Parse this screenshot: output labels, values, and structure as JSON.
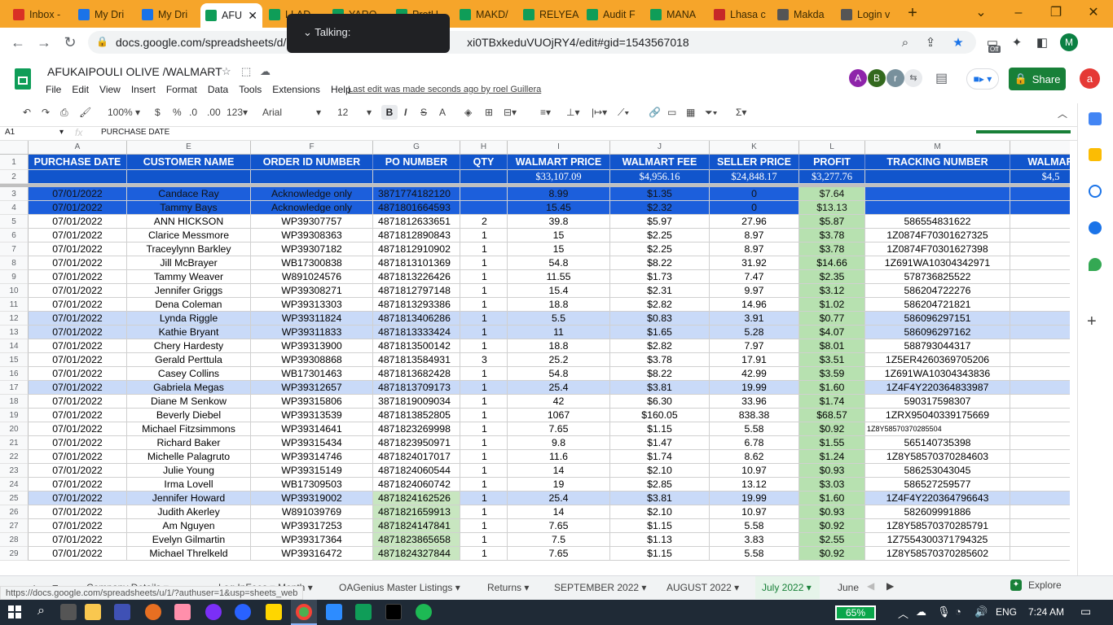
{
  "browser": {
    "tabs": [
      {
        "title": "Inbox -",
        "icon": "gmail-icon",
        "color": "#d93025"
      },
      {
        "title": "My Dri",
        "icon": "drive-icon",
        "color": "#1a73e8"
      },
      {
        "title": "My Dri",
        "icon": "drive-icon",
        "color": "#1a73e8"
      },
      {
        "title": "AFU",
        "icon": "sheets-icon",
        "color": "#0f9d58"
      },
      {
        "title": "LLAD",
        "icon": "sheets-icon",
        "color": "#0f9d58"
      },
      {
        "title": "YARO",
        "icon": "sheets-icon",
        "color": "#0f9d58"
      },
      {
        "title": "ProtU",
        "icon": "sheets-icon",
        "color": "#0f9d58"
      },
      {
        "title": "MAKD/",
        "icon": "sheets-icon",
        "color": "#0f9d58"
      },
      {
        "title": "RELYEA",
        "icon": "sheets-icon",
        "color": "#0f9d58"
      },
      {
        "title": "Audit F",
        "icon": "sheets-icon",
        "color": "#0f9d58"
      },
      {
        "title": "MANA",
        "icon": "sheets-icon",
        "color": "#0f9d58"
      },
      {
        "title": "Lhasa c",
        "icon": "vivaldi-icon",
        "color": "#c62828"
      },
      {
        "title": "Makda",
        "icon": "globe-icon",
        "color": "#555555"
      },
      {
        "title": "Login v",
        "icon": "globe-icon",
        "color": "#555555"
      }
    ],
    "url": "docs.google.com/spreadsheets/d/1",
    "url_tail": "xi0TBxkeduVUOjRY4/edit#gid=1543567018",
    "talking_popup": "Talking:",
    "profile_initial": "M",
    "ext_badge": "Off"
  },
  "sheet": {
    "title": "AFUKAIPOULI OLIVE /WALMART",
    "menu": [
      "File",
      "Edit",
      "View",
      "Insert",
      "Format",
      "Data",
      "Tools",
      "Extensions",
      "Help"
    ],
    "last_edit": "Last edit was made seconds ago by roel Guillera",
    "avatars": [
      {
        "letter": "A",
        "color": "#8e24aa"
      },
      {
        "letter": "B",
        "color": "#33691e"
      },
      {
        "letter": "r",
        "color": "#78909c"
      }
    ],
    "share_label": "Share",
    "account_initial": "a",
    "toolbar": {
      "zoom": "100%",
      "currency": "$",
      "percent": "%",
      "dec_less": ".0",
      "dec_more": ".00",
      "format": "123",
      "font": "Arial",
      "font_size": "12"
    },
    "cell_ref": "A1",
    "fx_label": "fx",
    "formula": "PURCHASE DATE"
  },
  "grid": {
    "columns": [
      {
        "letter": "A",
        "header": "PURCHASE DATE"
      },
      {
        "letter": "E",
        "header": "CUSTOMER NAME"
      },
      {
        "letter": "F",
        "header": "ORDER ID NUMBER"
      },
      {
        "letter": "G",
        "header": "PO NUMBER"
      },
      {
        "letter": "H",
        "header": "QTY"
      },
      {
        "letter": "I",
        "header": "WALMART PRICE"
      },
      {
        "letter": "J",
        "header": "WALMART FEE"
      },
      {
        "letter": "K",
        "header": "SELLER PRICE"
      },
      {
        "letter": "L",
        "header": "PROFIT"
      },
      {
        "letter": "M",
        "header": "TRACKING NUMBER"
      },
      {
        "letter": "",
        "header": "WALMAR"
      }
    ],
    "totals": {
      "I": "$33,107.09",
      "J": "$4,956.16",
      "K": "$24,848.17",
      "L": "$3,277.76",
      "N": "$4,5"
    },
    "rows": [
      {
        "n": "3",
        "style": "blue",
        "A": "07/01/2022",
        "E": "Candace Ray",
        "F": "Acknowledge only",
        "G": "3871774182120",
        "H": "",
        "I": "8.99",
        "J": "$1.35",
        "K": "0",
        "L": "$7.64",
        "M": ""
      },
      {
        "n": "4",
        "style": "blue",
        "A": "07/01/2022",
        "E": "Tammy Bays",
        "F": "Acknowledge only",
        "G": "4871801664593",
        "H": "",
        "I": "15.45",
        "J": "$2.32",
        "K": "0",
        "L": "$13.13",
        "M": ""
      },
      {
        "n": "5",
        "style": "",
        "A": "07/01/2022",
        "E": "ANN HICKSON",
        "F": "WP39307757",
        "G": "4871812633651",
        "H": "2",
        "I": "39.8",
        "J": "$5.97",
        "K": "27.96",
        "L": "$5.87",
        "M": "586554831622"
      },
      {
        "n": "6",
        "style": "",
        "A": "07/01/2022",
        "E": "Clarice Messmore",
        "F": "WP39308363",
        "G": "4871812890843",
        "H": "1",
        "I": "15",
        "J": "$2.25",
        "K": "8.97",
        "L": "$3.78",
        "M": "1Z0874F70301627325"
      },
      {
        "n": "7",
        "style": "",
        "A": "07/01/2022",
        "E": "Traceylynn Barkley",
        "F": "WP39307182",
        "G": "4871812910902",
        "H": "1",
        "I": "15",
        "J": "$2.25",
        "K": "8.97",
        "L": "$3.78",
        "M": "1Z0874F70301627398"
      },
      {
        "n": "8",
        "style": "",
        "A": "07/01/2022",
        "E": "Jill McBrayer",
        "F": "WB17300838",
        "G": "4871813101369",
        "H": "1",
        "I": "54.8",
        "J": "$8.22",
        "K": "31.92",
        "L": "$14.66",
        "M": "1Z691WA10304342971"
      },
      {
        "n": "9",
        "style": "",
        "A": "07/01/2022",
        "E": "Tammy Weaver",
        "F": "W891024576",
        "G": "4871813226426",
        "H": "1",
        "I": "11.55",
        "J": "$1.73",
        "K": "7.47",
        "L": "$2.35",
        "M": "578736825522"
      },
      {
        "n": "10",
        "style": "",
        "A": "07/01/2022",
        "E": "Jennifer Griggs",
        "F": "WP39308271",
        "G": "4871812797148",
        "H": "1",
        "I": "15.4",
        "J": "$2.31",
        "K": "9.97",
        "L": "$3.12",
        "M": "586204722276"
      },
      {
        "n": "11",
        "style": "",
        "A": "07/01/2022",
        "E": "Dena Coleman",
        "F": "WP39313303",
        "G": "4871813293386",
        "H": "1",
        "I": "18.8",
        "J": "$2.82",
        "K": "14.96",
        "L": "$1.02",
        "M": "586204721821"
      },
      {
        "n": "12",
        "style": "lblue",
        "A": "07/01/2022",
        "E": "Lynda Riggle",
        "F": "WP39311824",
        "G": "4871813406286",
        "H": "1",
        "I": "5.5",
        "J": "$0.83",
        "K": "3.91",
        "L": "$0.77",
        "M": "586096297151"
      },
      {
        "n": "13",
        "style": "lblue",
        "A": "07/01/2022",
        "E": "Kathie Bryant",
        "F": "WP39311833",
        "G": "4871813333424",
        "H": "1",
        "I": "11",
        "J": "$1.65",
        "K": "5.28",
        "L": "$4.07",
        "M": "586096297162"
      },
      {
        "n": "14",
        "style": "",
        "A": "07/01/2022",
        "E": "Chery Hardesty",
        "F": "WP39313900",
        "G": "4871813500142",
        "H": "1",
        "I": "18.8",
        "J": "$2.82",
        "K": "7.97",
        "L": "$8.01",
        "M": "588793044317"
      },
      {
        "n": "15",
        "style": "",
        "A": "07/01/2022",
        "E": "Gerald Perttula",
        "F": "WP39308868",
        "G": "4871813584931",
        "H": "3",
        "I": "25.2",
        "J": "$3.78",
        "K": "17.91",
        "L": "$3.51",
        "M": "1Z5ER4260369705206"
      },
      {
        "n": "16",
        "style": "",
        "A": "07/01/2022",
        "E": "Casey Collins",
        "F": "WB17301463",
        "G": "4871813682428",
        "H": "1",
        "I": "54.8",
        "J": "$8.22",
        "K": "42.99",
        "L": "$3.59",
        "M": "1Z691WA10304343836"
      },
      {
        "n": "17",
        "style": "lblue",
        "A": "07/01/2022",
        "E": "Gabriela Megas",
        "F": "WP39312657",
        "G": "4871813709173",
        "H": "1",
        "I": "25.4",
        "J": "$3.81",
        "K": "19.99",
        "L": "$1.60",
        "M": "1Z4F4Y220364833987"
      },
      {
        "n": "18",
        "style": "",
        "A": "07/01/2022",
        "E": "Diane M Senkow",
        "F": "WP39315806",
        "G": "3871819009034",
        "H": "1",
        "I": "42",
        "J": "$6.30",
        "K": "33.96",
        "L": "$1.74",
        "M": "590317598307"
      },
      {
        "n": "19",
        "style": "",
        "A": "07/01/2022",
        "E": "Beverly Diebel",
        "F": "WP39313539",
        "G": "4871813852805",
        "H": "1",
        "I": "1067",
        "J": "$160.05",
        "K": "838.38",
        "L": "$68.57",
        "M": "1ZRX95040339175669"
      },
      {
        "n": "20",
        "style": "",
        "A": "07/01/2022",
        "E": "Michael Fitzsimmons",
        "F": "WP39314641",
        "G": "4871823269998",
        "H": "1",
        "I": "7.65",
        "J": "$1.15",
        "K": "5.58",
        "L": "$0.92",
        "M": "1Z8Y58570370285504",
        "Msmall": true
      },
      {
        "n": "21",
        "style": "",
        "A": "07/01/2022",
        "E": "Richard Baker",
        "F": "WP39315434",
        "G": "4871823950971",
        "H": "1",
        "I": "9.8",
        "J": "$1.47",
        "K": "6.78",
        "L": "$1.55",
        "M": "565140735398"
      },
      {
        "n": "22",
        "style": "",
        "A": "07/01/2022",
        "E": "Michelle Palagruto",
        "F": "WP39314746",
        "G": "4871824017017",
        "H": "1",
        "I": "11.6",
        "J": "$1.74",
        "K": "8.62",
        "L": "$1.24",
        "M": "1Z8Y58570370284603"
      },
      {
        "n": "23",
        "style": "",
        "A": "07/01/2022",
        "E": "Julie Young",
        "F": "WP39315149",
        "G": "4871824060544",
        "H": "1",
        "I": "14",
        "J": "$2.10",
        "K": "10.97",
        "L": "$0.93",
        "M": "586253043045"
      },
      {
        "n": "24",
        "style": "",
        "A": "07/01/2022",
        "E": "Irma Lovell",
        "F": "WB17309503",
        "G": "4871824060742",
        "H": "1",
        "I": "19",
        "J": "$2.85",
        "K": "13.12",
        "L": "$3.03",
        "M": "586527259577"
      },
      {
        "n": "25",
        "style": "lblue",
        "A": "07/01/2022",
        "E": "Jennifer Howard",
        "F": "WP39319002",
        "G": "4871824162526",
        "H": "1",
        "I": "25.4",
        "J": "$3.81",
        "K": "19.99",
        "L": "$1.60",
        "M": "1Z4F4Y220364796643",
        "Ggreen": true
      },
      {
        "n": "26",
        "style": "",
        "A": "07/01/2022",
        "E": "Judith Akerley",
        "F": "W891039769",
        "G": "4871821659913",
        "H": "1",
        "I": "14",
        "J": "$2.10",
        "K": "10.97",
        "L": "$0.93",
        "M": "582609991886",
        "Ggreen": true
      },
      {
        "n": "27",
        "style": "",
        "A": "07/01/2022",
        "E": "Am Nguyen",
        "F": "WP39317253",
        "G": "4871824147841",
        "H": "1",
        "I": "7.65",
        "J": "$1.15",
        "K": "5.58",
        "L": "$0.92",
        "M": "1Z8Y58570370285791",
        "Ggreen": true
      },
      {
        "n": "28",
        "style": "",
        "A": "07/01/2022",
        "E": "Evelyn Gilmartin",
        "F": "WP39317364",
        "G": "4871823865658",
        "H": "1",
        "I": "7.5",
        "J": "$1.13",
        "K": "3.83",
        "L": "$2.55",
        "M": "1Z7554300371794325",
        "Ggreen": true
      },
      {
        "n": "29",
        "style": "",
        "A": "07/01/2022",
        "E": "Michael Threlkeld",
        "F": "WP39316472",
        "G": "4871824327844",
        "H": "1",
        "I": "7.65",
        "J": "$1.15",
        "K": "5.58",
        "L": "$0.92",
        "M": "1Z8Y58570370285602",
        "Ggreen": true
      }
    ]
  },
  "sheet_tabs": [
    "Company Details",
    "Log InFees",
    "Month",
    "OAGenius Master Listings",
    "Returns",
    "SEPTEMBER 2022",
    "AUGUST 2022",
    "July 2022",
    "June"
  ],
  "active_sheet_tab": "July 2022",
  "explore_label": "Explore",
  "status_url": "https://docs.google.com/spreadsheets/u/1/?authuser=1&usp=sheets_web",
  "taskbar": {
    "battery": "65%",
    "lang": "ENG",
    "time": "7:24 AM"
  }
}
